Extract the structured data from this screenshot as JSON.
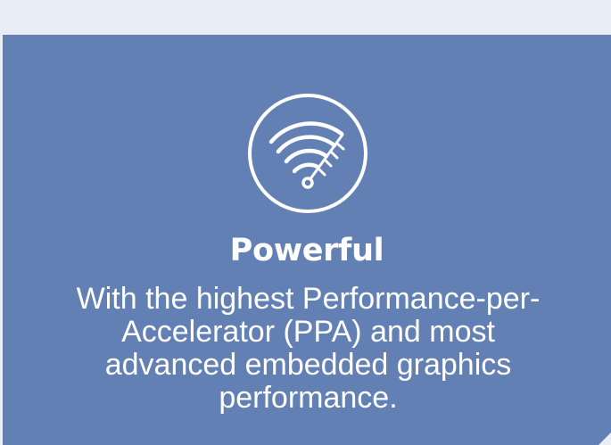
{
  "feature": {
    "icon": "gauge-speed-icon",
    "title": "Powerful",
    "description": "With the highest Performance-per-Accelerator (PPA) and most advanced embedded graphics performance."
  },
  "colors": {
    "background": "#e9edf5",
    "card": "#6380b5",
    "text": "#ffffff"
  }
}
